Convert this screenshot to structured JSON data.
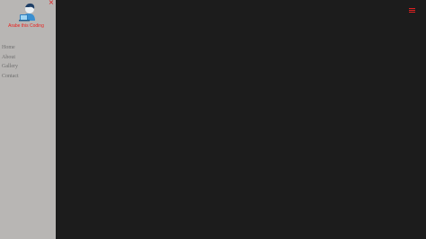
{
  "sidebar": {
    "close_glyph": "×",
    "brand": "Arabe this Coding",
    "logo_icon": "person-at-laptop-icon",
    "nav_items": [
      {
        "label": "Home"
      },
      {
        "label": "About"
      },
      {
        "label": "Gallery"
      },
      {
        "label": "Contact"
      }
    ]
  },
  "header": {
    "menu_icon": "hamburger-icon"
  },
  "colors": {
    "background": "#1c1c1c",
    "sidebar_background": "#b8b6b4",
    "accent": "#e02020",
    "nav_text": "#6e6e6e"
  }
}
